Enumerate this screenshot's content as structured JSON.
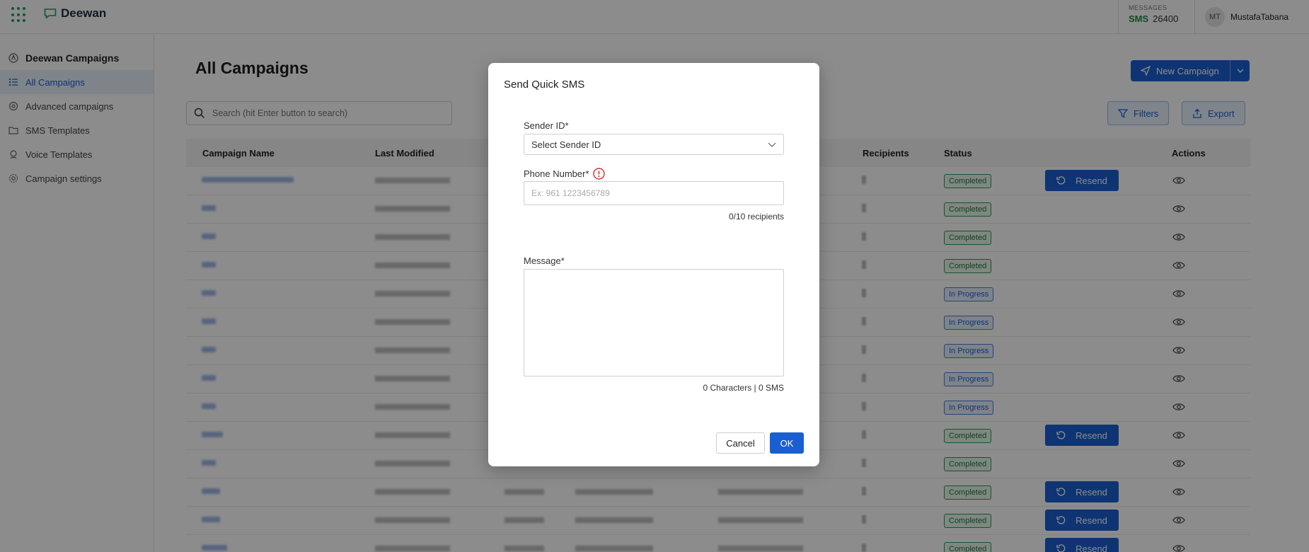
{
  "app": {
    "name": "Deewan"
  },
  "header": {
    "credits_label": "MESSAGES",
    "credits_type": "SMS",
    "credits_value": "26400",
    "user_initials": "MT",
    "user_name": "MustafaTabana"
  },
  "sidebar": {
    "title": "Deewan Campaigns",
    "items": [
      {
        "label": "All Campaigns",
        "icon": "list-icon",
        "active": true
      },
      {
        "label": "Advanced campaigns",
        "icon": "layers-icon",
        "active": false
      },
      {
        "label": "SMS Templates",
        "icon": "folder-icon",
        "active": false
      },
      {
        "label": "Voice Templates",
        "icon": "voice-icon",
        "active": false
      },
      {
        "label": "Campaign settings",
        "icon": "gear-icon",
        "active": false
      }
    ]
  },
  "main": {
    "title": "All Campaigns",
    "new_campaign_label": "New Campaign",
    "search_placeholder": "Search (hit Enter button to search)",
    "filters_label": "Filters",
    "export_label": "Export",
    "columns": {
      "name": "Campaign Name",
      "modified": "Last Modified",
      "recipients": "Recipients",
      "status": "Status",
      "actions": "Actions"
    },
    "resend_label": "Resend",
    "rows": [
      {
        "status": "Completed",
        "resend": true
      },
      {
        "status": "Completed",
        "resend": false
      },
      {
        "status": "Completed",
        "resend": false
      },
      {
        "status": "Completed",
        "resend": false
      },
      {
        "status": "In Progress",
        "resend": false
      },
      {
        "status": "In Progress",
        "resend": false
      },
      {
        "status": "In Progress",
        "resend": false
      },
      {
        "status": "In Progress",
        "resend": false
      },
      {
        "status": "In Progress",
        "resend": false
      },
      {
        "status": "Completed",
        "resend": true
      },
      {
        "status": "Completed",
        "resend": false
      },
      {
        "status": "Completed",
        "resend": true
      },
      {
        "status": "Completed",
        "resend": true
      },
      {
        "status": "Completed",
        "resend": true
      }
    ]
  },
  "modal": {
    "title": "Send Quick SMS",
    "sender_label": "Sender ID*",
    "sender_placeholder": "Select Sender ID",
    "phone_label": "Phone Number*",
    "phone_placeholder": "Ex: 961 1223456789",
    "recipients_count": "0/10 recipients",
    "message_label": "Message*",
    "message_value": "",
    "char_count": "0 Characters | 0 SMS",
    "cancel_label": "Cancel",
    "ok_label": "OK"
  },
  "colors": {
    "primary": "#1a5fd1",
    "brand_green": "#1fa05a",
    "completed": "#2b9a4e",
    "error": "#d32f2f"
  }
}
